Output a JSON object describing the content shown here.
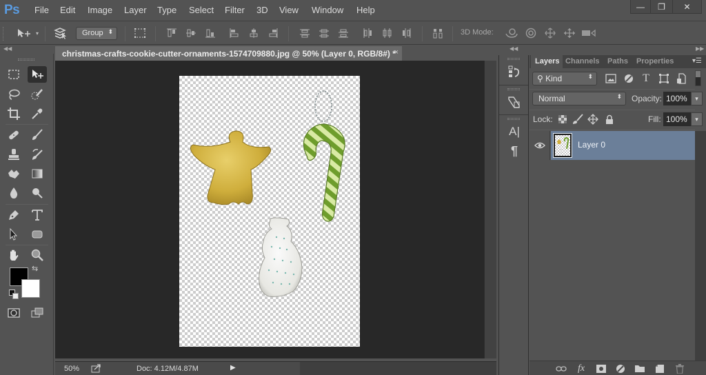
{
  "app": {
    "logo": "Ps",
    "menu": [
      "File",
      "Edit",
      "Image",
      "Layer",
      "Type",
      "Select",
      "Filter",
      "3D",
      "View",
      "Window",
      "Help"
    ],
    "window_controls": {
      "minimize": "—",
      "restore": "❐",
      "close": "✕"
    }
  },
  "options_bar": {
    "auto_select_value": "Group",
    "mode_3d_label": "3D Mode:",
    "icons": [
      "move-tool-icon",
      "auto-select-layers-icon",
      "transform-controls-icon",
      "align-top-icon",
      "align-vertical-center-icon",
      "align-bottom-icon",
      "align-left-icon",
      "align-horizontal-center-icon",
      "align-right-icon",
      "distribute-top-icon",
      "distribute-vertical-center-icon",
      "distribute-bottom-icon",
      "distribute-left-icon",
      "distribute-horizontal-center-icon",
      "distribute-right-icon",
      "auto-align-icon",
      "3d-rotate-icon",
      "3d-roll-icon",
      "3d-drag-icon",
      "3d-slide-icon",
      "3d-scale-icon"
    ]
  },
  "document": {
    "tab_title": "christmas-crafts-cookie-cutter-ornaments-1574709880.jpg @ 50% (Layer 0, RGB/8#) *",
    "tab_close": "×",
    "canvas_objects": [
      "gold angel ornament",
      "green striped candy cane ornament",
      "white snowman ornament"
    ]
  },
  "status_bar": {
    "zoom": "50%",
    "doc_size": "Doc: 4.12M/4.87M",
    "arrow": "▶"
  },
  "tools": {
    "foreground_color": "#000000",
    "background_color": "#ffffff",
    "swap_glyph": "⇆"
  },
  "mini_panels": {
    "icons": [
      "history-icon",
      "actions-icon",
      "character-icon",
      "paragraph-icon"
    ],
    "character_glyph": "A|",
    "paragraph_glyph": "¶"
  },
  "layers_panel": {
    "tabs": [
      "Layers",
      "Channels",
      "Paths",
      "Properties"
    ],
    "active_tab": "Layers",
    "filter_kind": "Kind",
    "blend_mode": "Normal",
    "opacity_label": "Opacity:",
    "opacity_value": "100%",
    "lock_label": "Lock:",
    "fill_label": "Fill:",
    "fill_value": "100%",
    "layers": [
      {
        "name": "Layer 0",
        "visible": true,
        "selected": true
      }
    ],
    "selection_color": "#6b7f99"
  }
}
